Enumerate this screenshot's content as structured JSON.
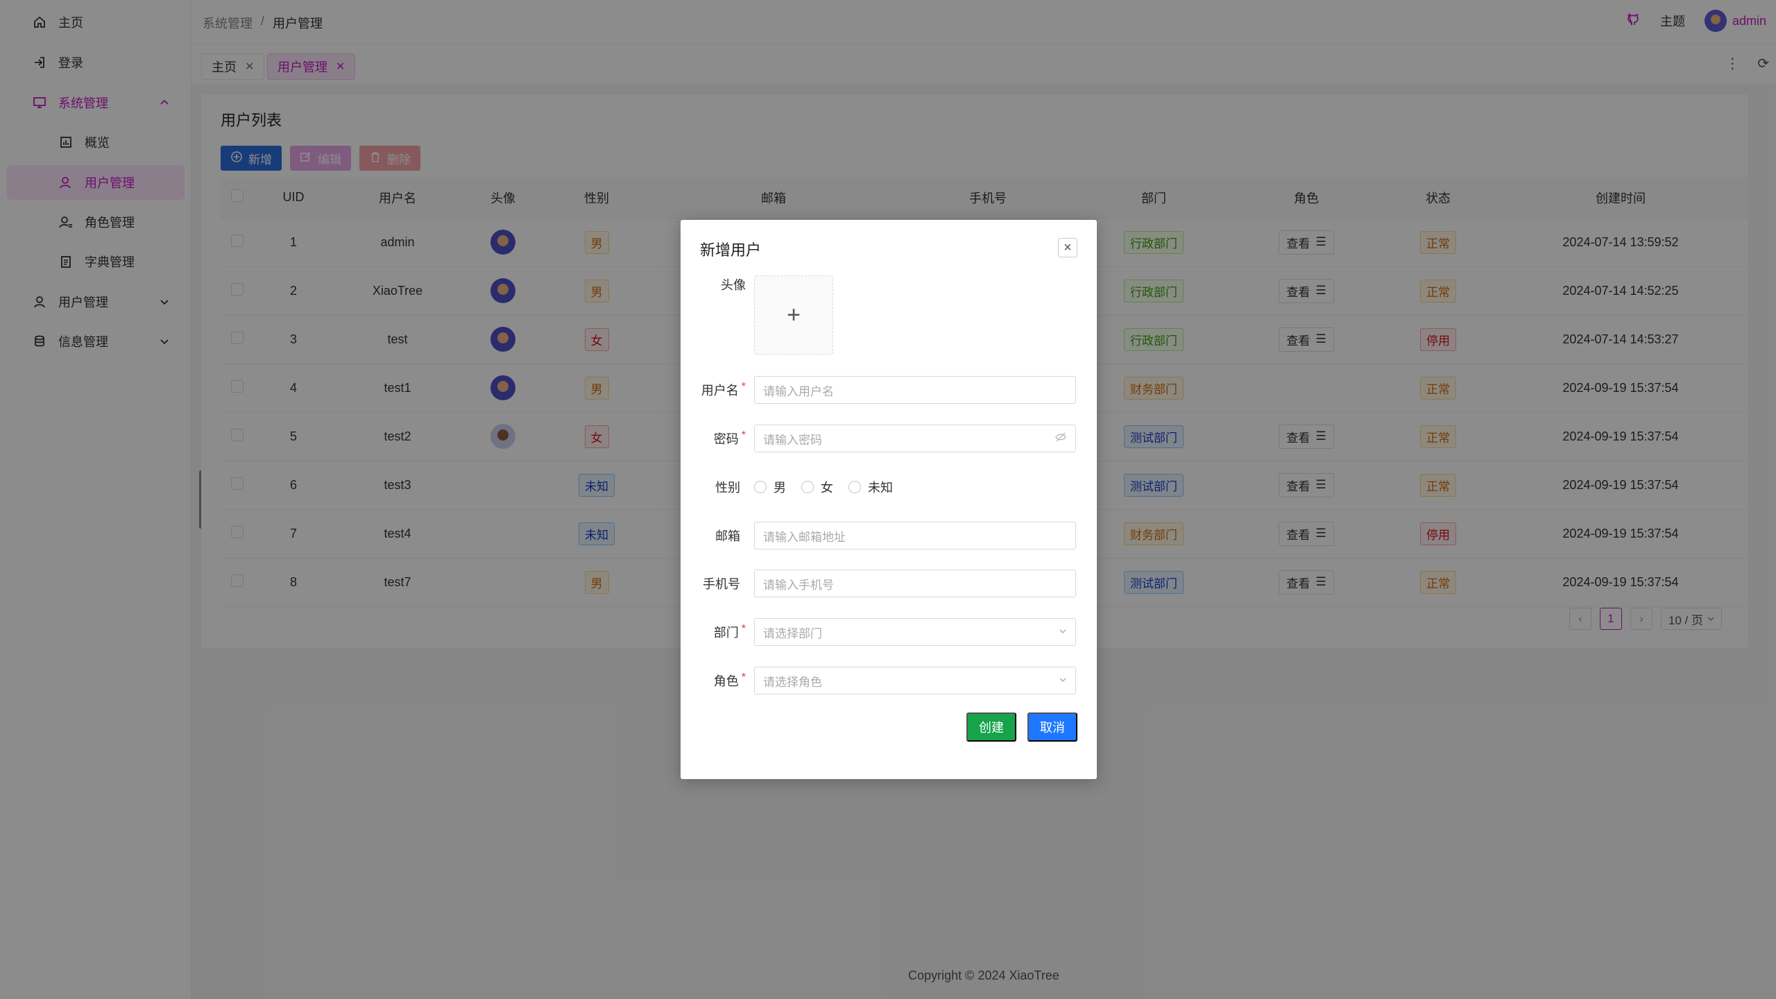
{
  "sidebar": {
    "items": [
      {
        "label": "主页",
        "icon": "home-icon"
      },
      {
        "label": "登录",
        "icon": "login-icon"
      },
      {
        "label": "系统管理",
        "icon": "monitor-icon"
      },
      {
        "label": "概览",
        "icon": "chart-icon"
      },
      {
        "label": "用户管理",
        "icon": "user-icon"
      },
      {
        "label": "角色管理",
        "icon": "user-cog-icon"
      },
      {
        "label": "字典管理",
        "icon": "clipboard-icon"
      },
      {
        "label": "用户管理",
        "icon": "user-icon"
      },
      {
        "label": "信息管理",
        "icon": "database-icon"
      }
    ]
  },
  "header": {
    "breadcrumb": [
      "系统管理",
      "/",
      "用户管理"
    ],
    "theme_label": "主题",
    "user_name": "admin"
  },
  "tabs": [
    {
      "label": "主页",
      "close": "✕"
    },
    {
      "label": "用户管理",
      "close": "✕"
    }
  ],
  "tab_tools": {
    "more": "⋮",
    "refresh": "⟳"
  },
  "page": {
    "title": "用户列表",
    "add_label": "新增",
    "edit_label": "编辑",
    "delete_label": "删除"
  },
  "table": {
    "headers": [
      "UID",
      "用户名",
      "头像",
      "性别",
      "邮箱",
      "手机号",
      "部门",
      "角色",
      "状态",
      "创建时间"
    ],
    "view_label": "查看",
    "rows": [
      {
        "uid": "1",
        "name": "admin",
        "gender": "男",
        "dept": "行政部门",
        "role": "查看",
        "status": "正常",
        "created": "2024-07-14 13:59:52"
      },
      {
        "uid": "2",
        "name": "XiaoTree",
        "gender": "男",
        "dept": "行政部门",
        "role": "查看",
        "status": "正常",
        "created": "2024-07-14 14:52:25"
      },
      {
        "uid": "3",
        "name": "test",
        "gender": "女",
        "dept": "行政部门",
        "role": "查看",
        "status": "停用",
        "created": "2024-07-14 14:53:27"
      },
      {
        "uid": "4",
        "name": "test1",
        "gender": "男",
        "dept": "财务部门",
        "role": "",
        "status": "正常",
        "created": "2024-09-19 15:37:54"
      },
      {
        "uid": "5",
        "name": "test2",
        "gender": "女",
        "dept": "测试部门",
        "role": "查看",
        "status": "正常",
        "created": "2024-09-19 15:37:54"
      },
      {
        "uid": "6",
        "name": "test3",
        "gender": "未知",
        "dept": "测试部门",
        "role": "查看",
        "status": "正常",
        "created": "2024-09-19 15:37:54"
      },
      {
        "uid": "7",
        "name": "test4",
        "gender": "未知",
        "dept": "财务部门",
        "role": "查看",
        "status": "停用",
        "created": "2024-09-19 15:37:54"
      },
      {
        "uid": "8",
        "name": "test7",
        "gender": "男",
        "dept": "测试部门",
        "role": "查看",
        "status": "正常",
        "created": "2024-09-19 15:37:54"
      }
    ]
  },
  "pagination": {
    "current": "1",
    "page_size": "10 / 页"
  },
  "footer": "Copyright © 2024 XiaoTree",
  "modal": {
    "title": "新增用户",
    "avatar_label": "头像",
    "username_label": "用户名",
    "username_placeholder": "请输入用户名",
    "password_label": "密码",
    "password_placeholder": "请输入密码",
    "gender_label": "性别",
    "gender_options": [
      "男",
      "女",
      "未知"
    ],
    "email_label": "邮箱",
    "email_placeholder": "请输入邮箱地址",
    "phone_label": "手机号",
    "phone_placeholder": "请输入手机号",
    "dept_label": "部门",
    "dept_placeholder": "请选择部门",
    "role_label": "角色",
    "role_placeholder": "请选择角色",
    "required_mark": "*",
    "create_label": "创建",
    "cancel_label": "取消"
  },
  "colors": {
    "accent": "#c41dc4",
    "primary": "#1e78ff",
    "success": "#16a34a"
  }
}
